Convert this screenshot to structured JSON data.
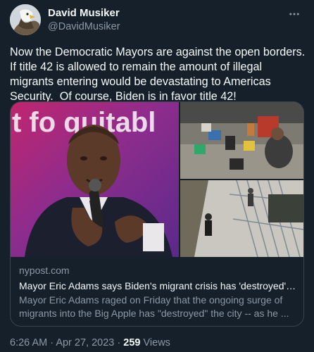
{
  "author": {
    "display_name": "David Musiker",
    "handle": "@DavidMusiker",
    "avatar_icon": "eagle-avatar-icon"
  },
  "tweet": {
    "text": "Now the Democratic Mayors are against the open borders. If title 42 is allowed to remain the amount of illegal migrants entering would be devastating to Americas Security.  Of course, Biden is in favor title 42!"
  },
  "card": {
    "banner_text": "t fo quitabl",
    "domain": "nypost.com",
    "title": "Mayor Eric Adams says Biden's migrant crisis has 'destroyed' N...",
    "description": "Mayor Eric Adams raged on Friday that the ongoing surge of migrants into the Big Apple has \"destroyed\" the city -- as he ..."
  },
  "meta": {
    "time": "6:26 AM",
    "separator": "·",
    "date": "Apr 27, 2023",
    "views_count": "259",
    "views_label": "Views"
  },
  "colors": {
    "background": "#15202b",
    "text_primary": "#f7f9f9",
    "text_secondary": "#8b98a5",
    "border": "#38444d"
  }
}
